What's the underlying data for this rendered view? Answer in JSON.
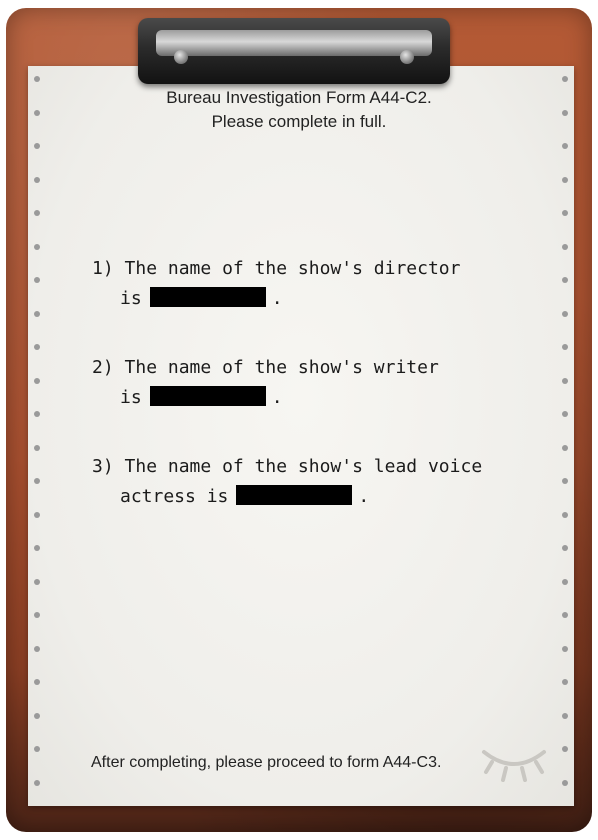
{
  "form": {
    "header_line1": "Bureau Investigation Form A44-C2.",
    "header_line2": "Please complete in full.",
    "questions": [
      {
        "number": "1)",
        "line1": "The name of the show's director",
        "line2_prefix": "is",
        "line2_suffix": "."
      },
      {
        "number": "2)",
        "line1": "The name of the show's writer",
        "line2_prefix": "is",
        "line2_suffix": "."
      },
      {
        "number": "3)",
        "line1": "The name of the show's lead voice",
        "line2_prefix": "actress is",
        "line2_suffix": "."
      }
    ],
    "footer": "After completing, please proceed to form A44-C3."
  },
  "colors": {
    "clipboard": "#a74f2f",
    "paper": "#f1f0ec",
    "ink": "#1b1b1b",
    "redaction": "#000000"
  },
  "icons": {
    "clip": "clipboard-clip-icon",
    "eye": "closed-eye-icon"
  }
}
